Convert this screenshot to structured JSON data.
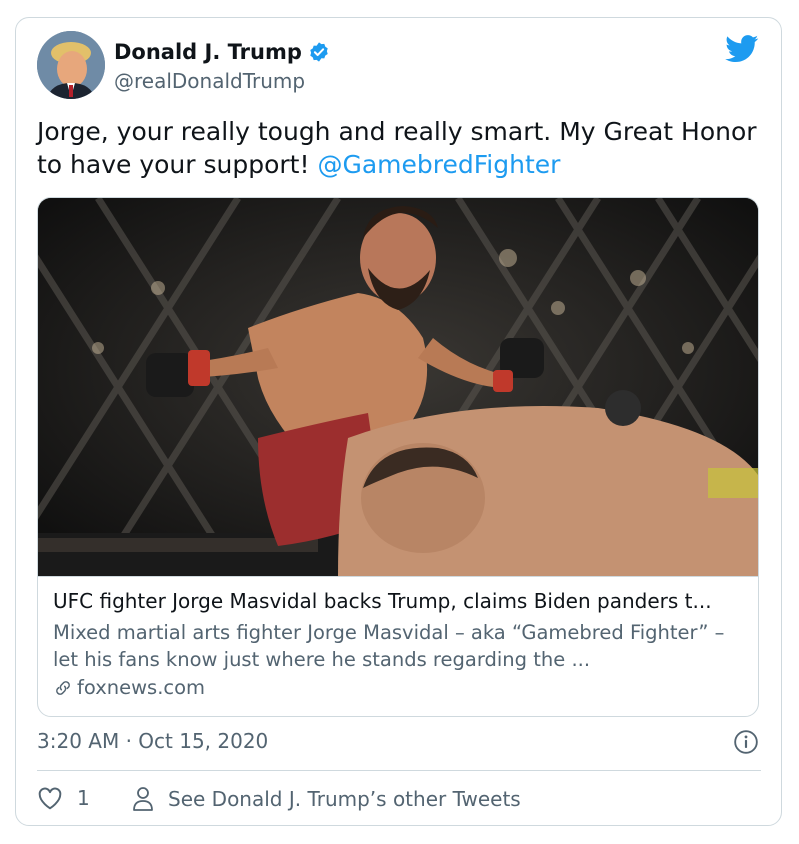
{
  "author": {
    "name": "Donald J. Trump",
    "handle": "@realDonaldTrump",
    "verified": true
  },
  "tweet": {
    "text": "Jorge, your really tough and really smart. My Great Honor to have your support! ",
    "mention": "@GamebredFighter"
  },
  "link_card": {
    "image_alt": "UFC fighter Jorge Masvidal kneeing opponent in the cage",
    "title": "UFC fighter Jorge Masvidal backs Trump, claims Biden panders t...",
    "description": "Mixed martial arts fighter Jorge Masvidal – aka “Gamebred Fighter” – let his fans know just where he stands regarding the ...",
    "domain": "foxnews.com"
  },
  "meta": {
    "timestamp": "3:20 AM · Oct 15, 2020"
  },
  "actions": {
    "like_count": "1",
    "profile_link": "See Donald J. Trump’s other Tweets"
  },
  "colors": {
    "accent": "#1d9bf0",
    "text_primary": "#0f1419",
    "text_secondary": "#536471",
    "border": "#cfd9de"
  },
  "icons": [
    "twitter-bird-icon",
    "verified-badge-icon",
    "link-icon",
    "info-icon",
    "heart-icon",
    "person-icon"
  ]
}
